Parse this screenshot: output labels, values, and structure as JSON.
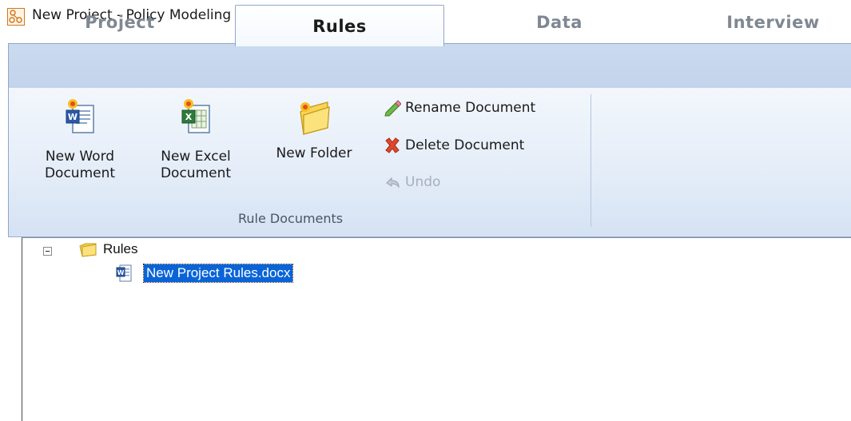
{
  "window": {
    "title": "New Project - Policy Modeling",
    "icon": "policy-modeling-app-icon"
  },
  "tabs": [
    {
      "label": "Project",
      "active": false
    },
    {
      "label": "Rules",
      "active": true
    },
    {
      "label": "Data",
      "active": false
    },
    {
      "label": "Interview",
      "active": false
    }
  ],
  "ribbon": {
    "group_label": "Rule Documents",
    "new_word": {
      "label": "New Word\nDocument",
      "icon": "word-document-new-icon"
    },
    "new_excel": {
      "label": "New Excel\nDocument",
      "icon": "excel-document-new-icon"
    },
    "new_folder": {
      "label": "New Folder",
      "icon": "folder-new-icon"
    },
    "rename": {
      "label": "Rename Document",
      "icon": "pencil-icon"
    },
    "delete": {
      "label": "Delete Document",
      "icon": "red-x-icon"
    },
    "undo": {
      "label": "Undo",
      "icon": "undo-icon",
      "enabled": false
    }
  },
  "tree": {
    "root": {
      "label": "Rules",
      "expanded": true,
      "icon": "folder-icon"
    },
    "children": [
      {
        "label": "New Project Rules.docx",
        "selected": true,
        "icon": "word-doc-icon"
      }
    ]
  },
  "colors": {
    "ribbon_bg": "#c9d9ef",
    "selection": "#0a64d8"
  }
}
